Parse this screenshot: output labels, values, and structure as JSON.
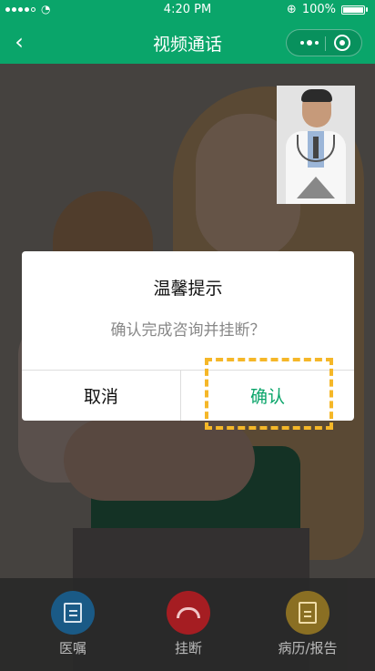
{
  "status_bar": {
    "time": "4:20 PM",
    "battery": "100%"
  },
  "nav": {
    "title": "视频通话"
  },
  "dialog": {
    "title": "温馨提示",
    "message": "确认完成咨询并挂断？",
    "cancel_label": "取消",
    "confirm_label": "确认"
  },
  "actions": [
    {
      "label": "医嘱",
      "icon": "notes-icon"
    },
    {
      "label": "挂断",
      "icon": "hangup-icon"
    },
    {
      "label": "病历/报告",
      "icon": "report-icon"
    }
  ],
  "colors": {
    "brand": "#0aa56a",
    "highlight": "#f5b728"
  }
}
